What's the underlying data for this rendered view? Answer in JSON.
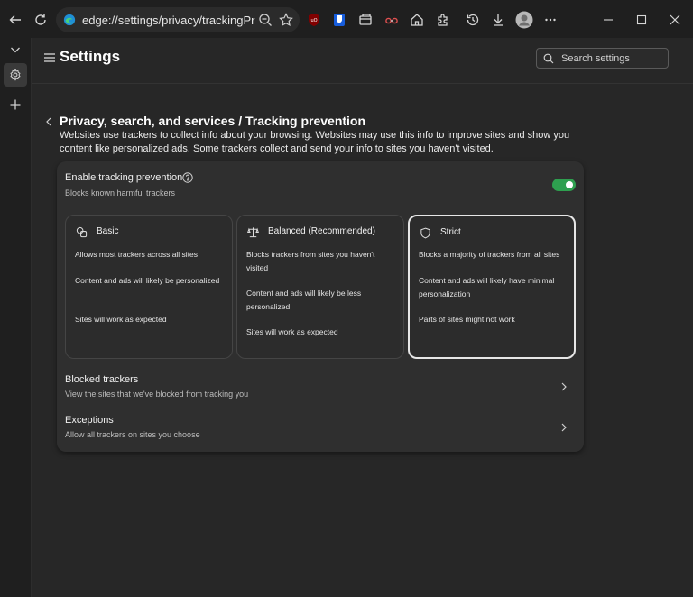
{
  "browser": {
    "url": "edge://settings/privacy/trackingPrev...",
    "icons": [
      "back-arrow-icon",
      "refresh-icon",
      "edge-logo-icon",
      "zoom-out-icon",
      "favorite-star-icon",
      "ublock-icon",
      "bitwarden-icon",
      "tab-icon",
      "reader-icon",
      "home-icon",
      "extensions-icon",
      "history-icon",
      "download-icon",
      "profile-icon",
      "more-icon",
      "minimize-icon",
      "maximize-icon",
      "close-icon"
    ]
  },
  "sidebar": {
    "icons": [
      "chevron-down-icon",
      "settings-gear-icon",
      "plus-icon"
    ]
  },
  "header": {
    "title": "Settings",
    "search_placeholder": "Search settings"
  },
  "page": {
    "title": "Privacy, search, and services / Tracking prevention",
    "description": "Websites use trackers to collect info about your browsing. Websites may use this info to improve sites and show you content like personalized ads. Some trackers collect and send your info to sites you haven't visited."
  },
  "tracking": {
    "enable_label": "Enable tracking prevention",
    "enable_sub": "Blocks known harmful trackers",
    "enabled": true,
    "options": [
      {
        "title": "Basic",
        "lines": [
          "Allows most trackers across all sites",
          "Content and ads will likely be personalized",
          "Sites will work as expected"
        ]
      },
      {
        "title": "Balanced (Recommended)",
        "lines": [
          "Blocks trackers from sites you haven't visited",
          "Content and ads will likely be less personalized",
          "Sites will work as expected"
        ]
      },
      {
        "title": "Strict",
        "lines": [
          "Blocks a majority of trackers from all sites",
          "Content and ads will likely have minimal personalization",
          "Parts of sites might not work"
        ]
      }
    ],
    "selected": "Strict"
  },
  "rows": [
    {
      "title": "Blocked trackers",
      "sub": "View the sites that we've blocked from tracking you"
    },
    {
      "title": "Exceptions",
      "sub": "Allow all trackers on sites you choose"
    }
  ],
  "colors": {
    "toggle_on": "#2e9f4f",
    "background": "#272727",
    "card": "#2f2f2f"
  }
}
